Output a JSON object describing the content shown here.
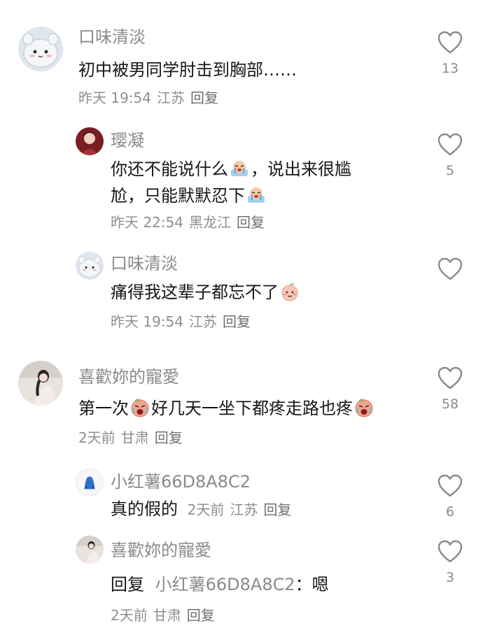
{
  "comments": [
    {
      "username": "口味清淡",
      "text": "初中被男同学肘击到胸部……",
      "time": "昨天 19:54",
      "location": "江苏",
      "reply": "回复",
      "likes": "13",
      "avatar_icon": "hamster-avatar-icon",
      "replies": [
        {
          "username": "璎凝",
          "text1": "你还不能说什么",
          "text2": "，说出来很尴",
          "text3": "尬，只能默默忍下",
          "time": "昨天 22:54",
          "location": "黑龙江",
          "reply": "回复",
          "likes": "5",
          "emoji": "crying-emoji-icon"
        },
        {
          "username": "口味清淡",
          "text": "痛得我这辈子都忘不了",
          "time": "昨天 19:54",
          "location": "江苏",
          "reply": "回复",
          "likes": "",
          "emoji": "peach-face-emoji-icon"
        }
      ]
    },
    {
      "username": "喜歡妳的寵愛",
      "text1": "第一次",
      "text2": "好几天一坐下都疼走路也疼",
      "time": "2天前",
      "location": "甘肃",
      "reply": "回复",
      "likes": "58",
      "emoji": "screaming-emoji-icon",
      "replies": [
        {
          "username": "小红薯66D8A8C2",
          "text": "真的假的",
          "time": "2天前",
          "location": "江苏",
          "reply": "回复",
          "likes": "6"
        },
        {
          "username": "喜歡妳的寵愛",
          "reply_label": "回复",
          "at_user": "小红薯66D8A8C2",
          "text": "：嗯",
          "time": "2天前",
          "location": "甘肃",
          "reply": "回复",
          "likes": "3"
        }
      ]
    }
  ],
  "colors": {
    "text": "#161616",
    "secondary": "#8a8a8a",
    "heart_outline": "#8a8a8a"
  }
}
